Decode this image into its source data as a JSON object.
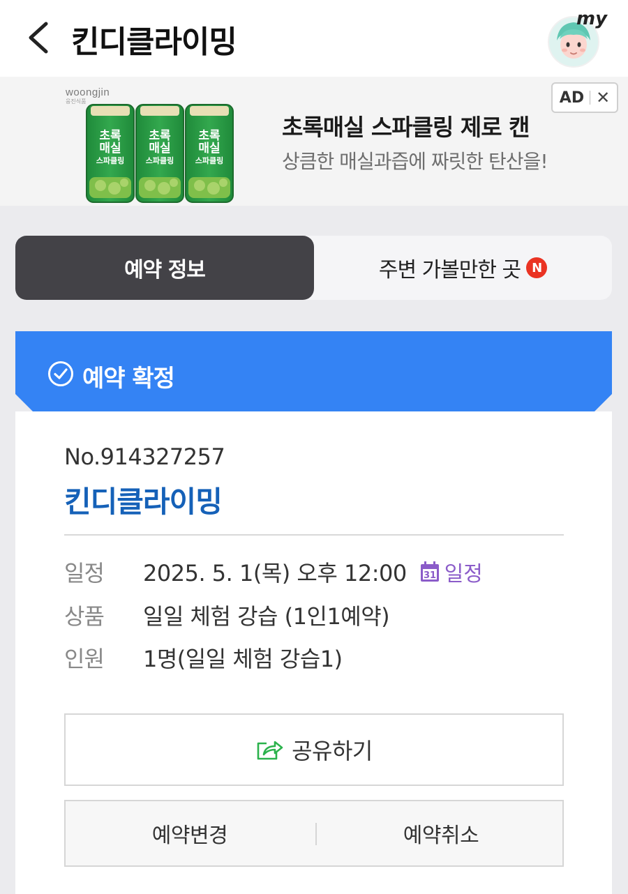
{
  "header": {
    "title": "킨디클라이밍",
    "my_label": "my"
  },
  "ad": {
    "brand": "woongjin",
    "brand_sub": "웅진식품",
    "can_label_line1": "초록",
    "can_label_line2": "매실",
    "can_label_line3": "스파클링",
    "headline": "초록매실 스파클링 제로 캔",
    "subline": "상큼한 매실과즙에 짜릿한 탄산을!",
    "badge": "AD",
    "close": "✕"
  },
  "tabs": [
    {
      "label": "예약 정보",
      "active": true
    },
    {
      "label": "주변 가볼만한 곳",
      "active": false,
      "badge": "N"
    }
  ],
  "status": {
    "label": "예약 확정",
    "color": "#3483f4"
  },
  "booking": {
    "number": "No.914327257",
    "venue": "킨디클라이밍",
    "rows": [
      {
        "label": "일정",
        "value": "2025. 5. 1(목) 오후 12:00"
      },
      {
        "label": "상품",
        "value": "일일 체험 강습 (1인1예약)"
      },
      {
        "label": "인원",
        "value": "1명(일일 체험 강습1)"
      }
    ],
    "calendar_link": "일정",
    "calendar_icon_day": "31"
  },
  "actions": {
    "share": "공유하기",
    "change": "예약변경",
    "cancel": "예약취소"
  },
  "colors": {
    "accent_blue": "#3483f4",
    "venue_blue": "#1561b8",
    "calendar_purple": "#8b5cc9",
    "share_green": "#2bb24c",
    "tab_dark": "#434247",
    "new_badge_red": "#ea3323"
  }
}
